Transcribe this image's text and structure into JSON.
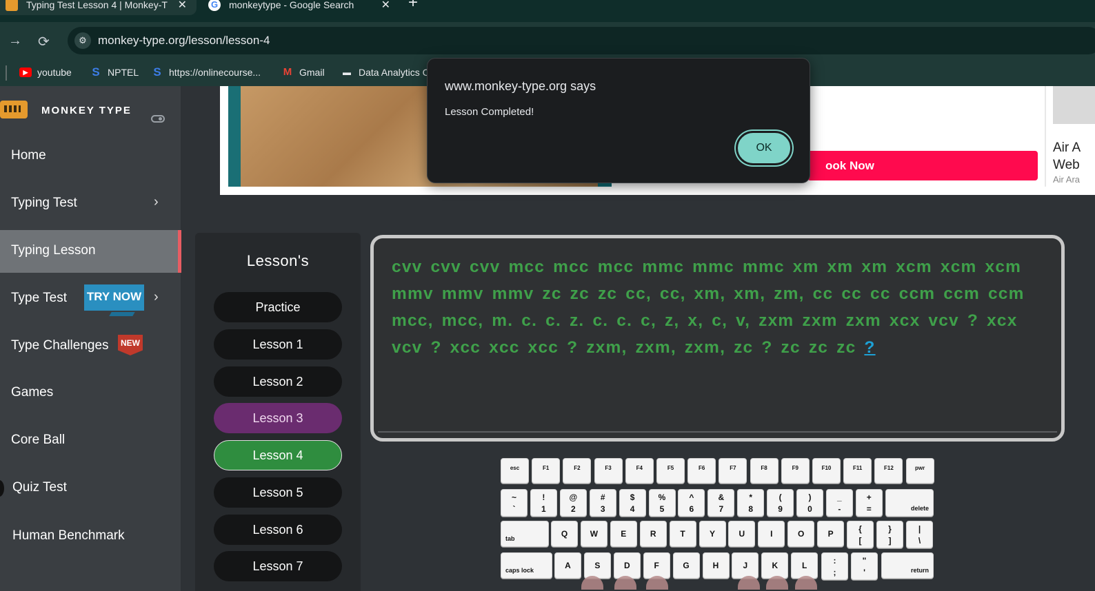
{
  "browser": {
    "tabs": [
      {
        "title": "Typing Test Lesson 4 | Monkey-T",
        "active": true
      },
      {
        "title": "monkeytype - Google Search",
        "active": false
      }
    ],
    "close_glyph": "✕",
    "newtab_glyph": "+",
    "url": "monkey-type.org/lesson/lesson-4",
    "bookmarks": [
      {
        "label": "youtube",
        "icon": "youtube-icon"
      },
      {
        "label": "NPTEL",
        "icon": "swayam-icon"
      },
      {
        "label": "https://onlinecourse...",
        "icon": "swayam-icon"
      },
      {
        "label": "Gmail",
        "icon": "gmail-icon"
      },
      {
        "label": "Data Analytics C",
        "icon": "data-icon"
      }
    ]
  },
  "sidebar": {
    "brand": "MONKEY TYPE",
    "items": [
      {
        "label": "Home"
      },
      {
        "label": "Typing Test",
        "chevron": "›"
      },
      {
        "label": "Typing Lesson",
        "active": true
      },
      {
        "label": "Type Test",
        "chevron": "›",
        "badge": "TRY NOW"
      },
      {
        "label": "Type Challenges",
        "badge": "NEW"
      },
      {
        "label": "Games"
      },
      {
        "label": "Core Ball"
      },
      {
        "label": "Quiz Test"
      },
      {
        "label": "Human Benchmark"
      }
    ]
  },
  "ad": {
    "cta": "ook Now",
    "side_line1": "Air A",
    "side_line2": "Web",
    "side_line3": "Air Ara"
  },
  "lessons": {
    "title": "Lesson's",
    "buttons": [
      "Practice",
      "Lesson 1",
      "Lesson 2",
      "Lesson 3",
      "Lesson 4",
      "Lesson 5",
      "Lesson 6",
      "Lesson 7"
    ],
    "highlighted": "Lesson 3",
    "current": "Lesson 4"
  },
  "typing": {
    "text": "cvv cvv cvv mcc mcc mcc mmc mmc mmc xm xm xm xcm xcm xcm mmv mmv mmv zc zc zc cc, cc, xm, xm, zm, cc cc cc ccm ccm ccm mcc, mcc, m. c. c. z. c. c. c, z, x, c, v, zxm zxm zxm xcx vcv ? xcx vcv ? xcc xcc xcc ? zxm, zxm, zxm, zc ? zc zc zc ",
    "cursor_char": "?",
    "text_color": "#3fa04a"
  },
  "keyboard": {
    "frow": [
      "esc",
      "F1",
      "F2",
      "F3",
      "F4",
      "F5",
      "F6",
      "F7",
      "F8",
      "F9",
      "F10",
      "F11",
      "F12",
      "pwr"
    ],
    "nrow": [
      [
        "~",
        "`"
      ],
      [
        "!",
        "1"
      ],
      [
        "@",
        "2"
      ],
      [
        "#",
        "3"
      ],
      [
        "$",
        "4"
      ],
      [
        "%",
        "5"
      ],
      [
        "^",
        "6"
      ],
      [
        "&",
        "7"
      ],
      [
        "*",
        "8"
      ],
      [
        "(",
        "9"
      ],
      [
        ")",
        "0"
      ],
      [
        "_",
        "-"
      ],
      [
        "+",
        "="
      ]
    ],
    "delete": "delete",
    "tab": "tab",
    "qrow": [
      "Q",
      "W",
      "E",
      "R",
      "T",
      "Y",
      "U",
      "I",
      "O",
      "P"
    ],
    "qrow_sym": [
      [
        "{",
        "["
      ],
      [
        "}",
        "]"
      ],
      [
        "|",
        "\\"
      ]
    ],
    "caps": "caps lock",
    "arow": [
      "A",
      "S",
      "D",
      "F",
      "G",
      "H",
      "J",
      "K",
      "L"
    ],
    "arow_sym": [
      [
        ":",
        ";"
      ],
      [
        "\"",
        "'"
      ]
    ],
    "return": "return"
  },
  "dialog": {
    "title": "www.monkey-type.org says",
    "message": "Lesson Completed!",
    "ok": "OK"
  }
}
